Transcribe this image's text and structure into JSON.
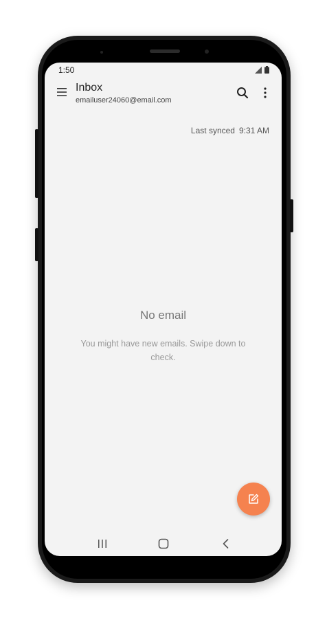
{
  "status_bar": {
    "time": "1:50",
    "icons": [
      "signal-icon",
      "battery-icon"
    ]
  },
  "app_bar": {
    "title": "Inbox",
    "account": "emailuser24060@email.com",
    "icons": [
      "menu-icon",
      "search-icon",
      "more-options-icon"
    ]
  },
  "sync": {
    "label": "Last synced",
    "time": "9:31 AM"
  },
  "empty_state": {
    "title": "No email",
    "message": "You might have new emails. Swipe down to check."
  },
  "fab": {
    "icon": "compose-icon",
    "color": "#f5824f"
  },
  "nav_bar": {
    "icons": [
      "recent-apps-icon",
      "home-icon",
      "back-icon"
    ]
  }
}
